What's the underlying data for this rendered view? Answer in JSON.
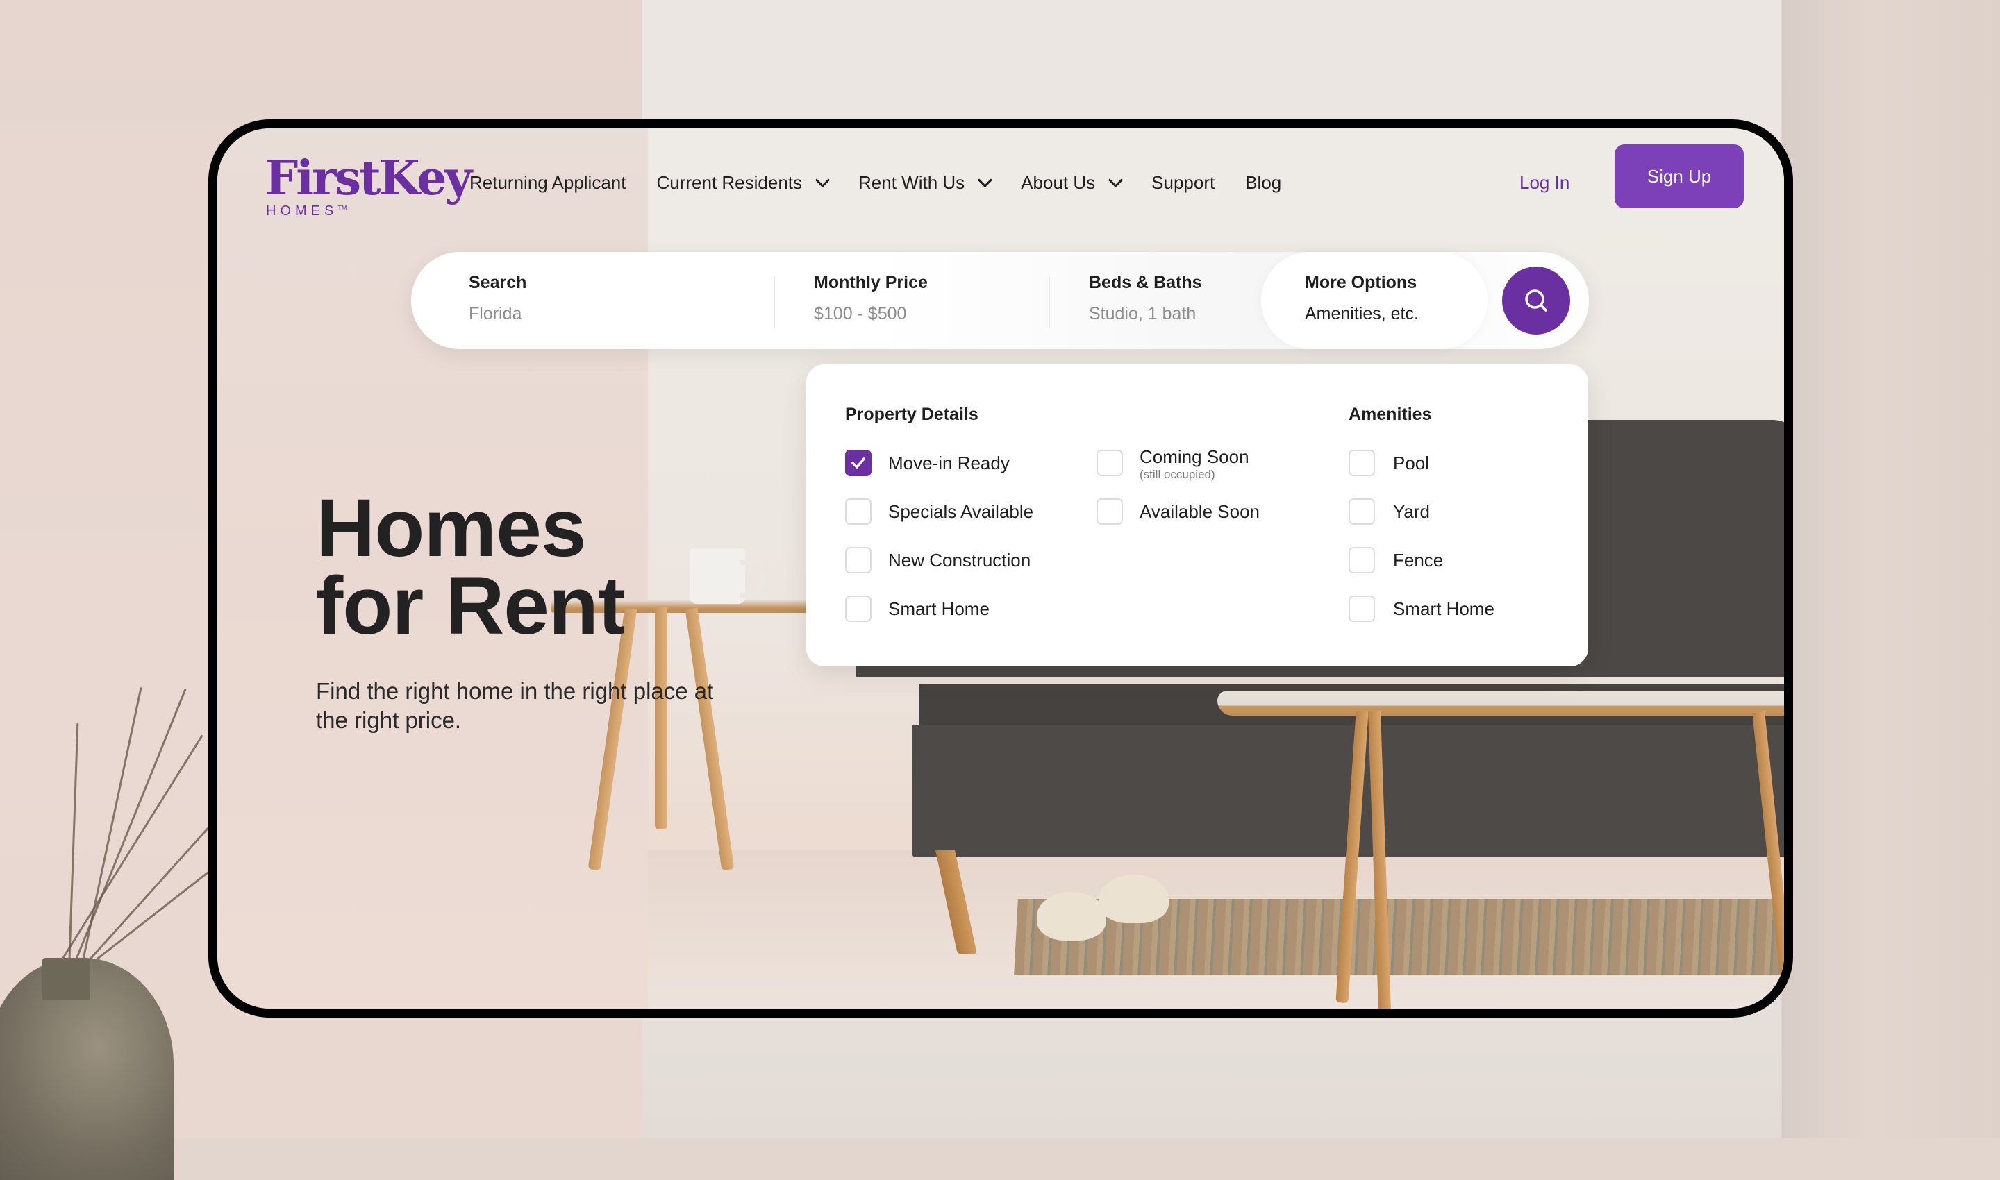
{
  "brand": {
    "name": "FirstKey",
    "subline": "HOMES",
    "trademark": "TM",
    "color": "#6a2fa0"
  },
  "nav": {
    "items": [
      {
        "label": "Returning Applicant",
        "has_dropdown": false
      },
      {
        "label": "Current Residents",
        "has_dropdown": true
      },
      {
        "label": "Rent With Us",
        "has_dropdown": true
      },
      {
        "label": "About Us",
        "has_dropdown": true
      },
      {
        "label": "Support",
        "has_dropdown": false
      },
      {
        "label": "Blog",
        "has_dropdown": false
      }
    ],
    "login_label": "Log In",
    "signup_label": "Sign Up",
    "signup_color": "#7c40b8"
  },
  "search": {
    "segments": [
      {
        "label": "Search",
        "value": "Florida"
      },
      {
        "label": "Monthly Price",
        "value": "$100 - $500"
      },
      {
        "label": "Beds & Baths",
        "value": "Studio, 1 bath"
      },
      {
        "label": "More Options",
        "value": "Amenities, etc.",
        "active": true
      }
    ],
    "button_icon": "search-icon"
  },
  "filters": {
    "property_details": {
      "title": "Property Details",
      "options": [
        {
          "label": "Move-in Ready",
          "checked": true
        },
        {
          "label": "Specials Available",
          "checked": false
        },
        {
          "label": "New Construction",
          "checked": false
        },
        {
          "label": "Smart Home",
          "checked": false
        },
        {
          "label": "Coming Soon",
          "sublabel": "(still occupied)",
          "checked": false
        },
        {
          "label": "Available Soon",
          "checked": false
        }
      ]
    },
    "amenities": {
      "title": "Amenities",
      "options": [
        {
          "label": "Pool",
          "checked": false
        },
        {
          "label": "Yard",
          "checked": false
        },
        {
          "label": "Fence",
          "checked": false
        },
        {
          "label": "Smart Home",
          "checked": false
        }
      ]
    }
  },
  "hero": {
    "title_line1": "Homes",
    "title_line2": "for Rent",
    "subtitle": "Find the right home in the right place at the right price."
  }
}
